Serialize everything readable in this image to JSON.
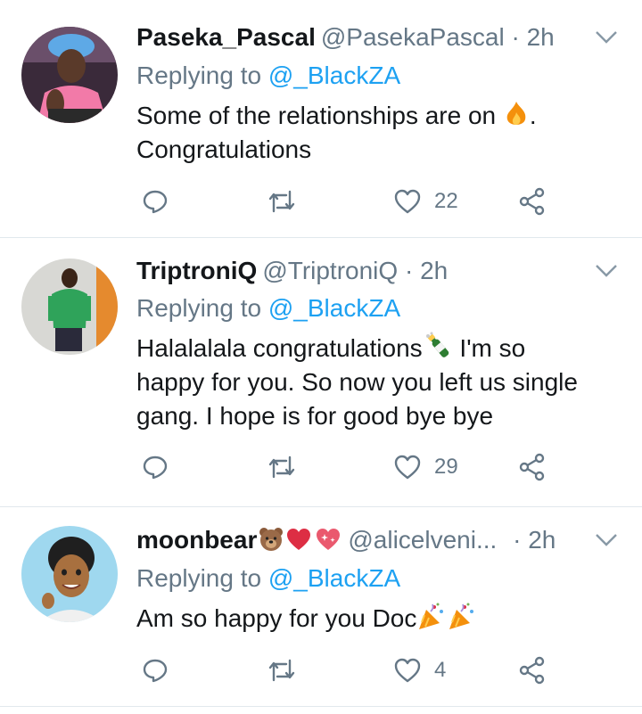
{
  "replies": [
    {
      "name": "Paseka_Pascal",
      "handle": "@PasekaPascal",
      "separator": "·",
      "time": "2h",
      "replying_prefix": "Replying to",
      "replying_to": "@_BlackZA",
      "text_part1": "Some of the relationships are on",
      "text_part1_end": ".",
      "text_line2": "Congratulations",
      "inline_emoji": "fire-emoji",
      "likes": "22"
    },
    {
      "name": "TriptroniQ",
      "handle": "@TriptroniQ",
      "separator": "·",
      "time": "2h",
      "replying_prefix": "Replying to",
      "replying_to": "@_BlackZA",
      "text_line1_a": "Halalalala congratulations",
      "text_line1_b": " I'm so",
      "text_line2": "happy for you. So now you left us single",
      "text_line3": "gang. I hope is for good bye bye",
      "inline_emoji": "champagne-emoji",
      "likes": "29"
    },
    {
      "name": "moonbear",
      "name_emojis": [
        "bear-face-emoji",
        "red-heart-emoji",
        "sparkling-heart-emoji"
      ],
      "handle": "@alicelveni...",
      "separator": "·",
      "time": "2h",
      "replying_prefix": "Replying to",
      "replying_to": "@_BlackZA",
      "text": "Am so happy for you Doc",
      "inline_emojis": [
        "party-popper-emoji",
        "party-popper-emoji"
      ],
      "likes": "4"
    }
  ],
  "colors": {
    "text": "#14171a",
    "muted": "#657786",
    "link": "#1da1f2",
    "divider": "#e1e8ed"
  }
}
